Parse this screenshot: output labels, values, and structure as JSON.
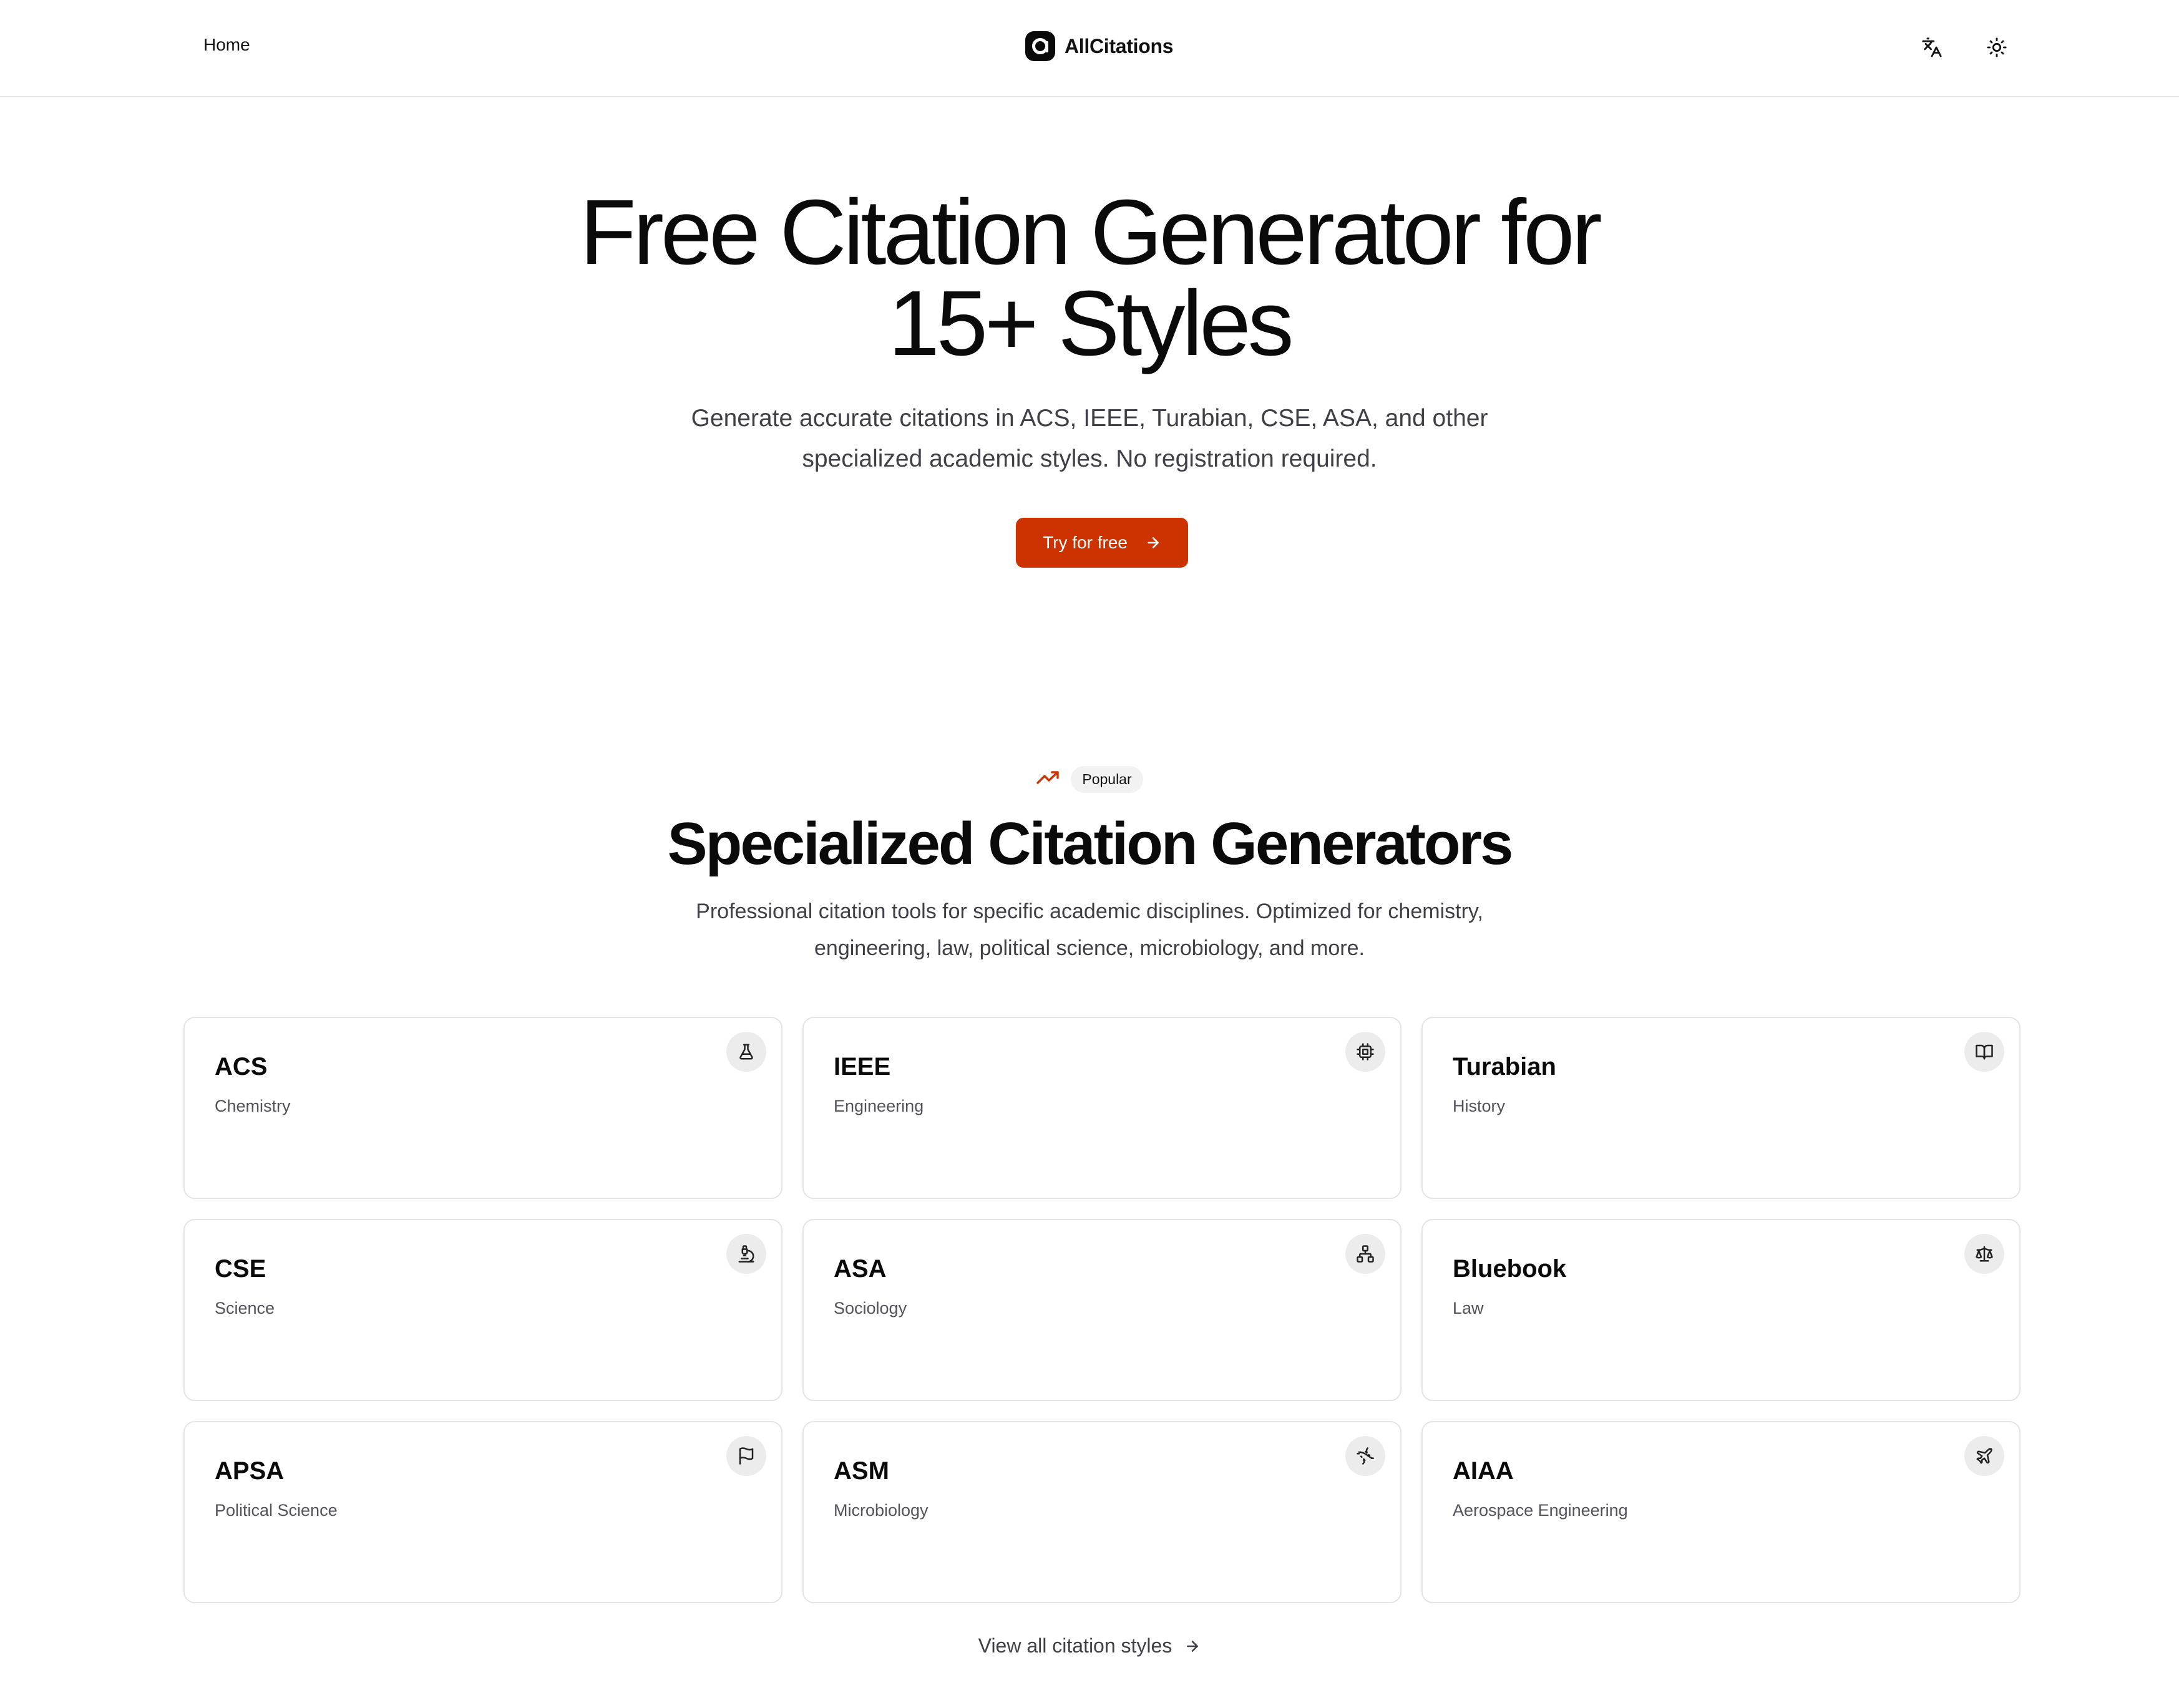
{
  "header": {
    "home_label": "Home",
    "brand_name": "AllCitations",
    "lang_icon": "translate-icon",
    "theme_icon": "sun-icon"
  },
  "hero": {
    "title_line1": "Free Citation Generator for",
    "title_line2": "15+ Styles",
    "subtitle_line1": "Generate accurate citations in ACS, IEEE, Turabian, CSE, ASA, and other",
    "subtitle_line2": "specialized academic styles. No registration required.",
    "cta_label": "Try for free",
    "cta_color": "#cc3300"
  },
  "popular": {
    "badge_label": "Popular",
    "title": "Specialized Citation Generators",
    "subtitle_line1": "Professional citation tools for specific academic disciplines. Optimized for chemistry,",
    "subtitle_line2": "engineering, law, political science, microbiology, and more.",
    "cards": [
      {
        "title": "ACS",
        "subtitle": "Chemistry",
        "icon": "flask-icon"
      },
      {
        "title": "IEEE",
        "subtitle": "Engineering",
        "icon": "cpu-chip-icon"
      },
      {
        "title": "Turabian",
        "subtitle": "History",
        "icon": "book-open-icon"
      },
      {
        "title": "CSE",
        "subtitle": "Science",
        "icon": "microscope-icon"
      },
      {
        "title": "ASA",
        "subtitle": "Sociology",
        "icon": "network-icon"
      },
      {
        "title": "Bluebook",
        "subtitle": "Law",
        "icon": "scales-icon"
      },
      {
        "title": "APSA",
        "subtitle": "Political Science",
        "icon": "flag-icon"
      },
      {
        "title": "ASM",
        "subtitle": "Microbiology",
        "icon": "dna-icon"
      },
      {
        "title": "AIAA",
        "subtitle": "Aerospace Engineering",
        "icon": "rocket-icon"
      }
    ],
    "view_all_label": "View all citation styles"
  }
}
